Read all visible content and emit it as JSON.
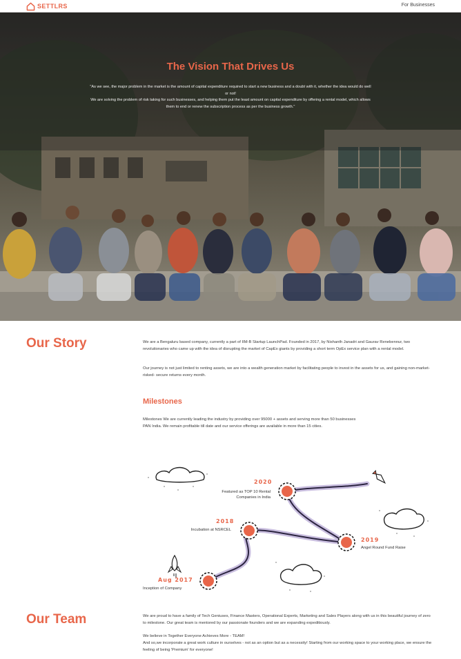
{
  "nav": {
    "logo_text": "SETTLRS",
    "for_businesses": "For Businesses"
  },
  "hero": {
    "title": "The Vision That Drives Us",
    "quote_line1": "\"As we see, the major problem in the market is the amount of capital expenditure required to start a new business and a doubt with it, whether the idea would do well or not!",
    "quote_line2": "We are solving the problem of risk taking for such businesses, and helping them put the least amount on capital expenditure by offering a rental model, which allows them to end or renew the subscription process as per the business growth.\""
  },
  "story": {
    "title": "Our Story",
    "para1": "We are a Bengaluru based company, currently a part of IIM-B Startup LaunchPad. Founded in 2017, by Nishanth Janadri and Gaurav Renebennur, two revolutionaries who came up with the idea of disrupting the market of CapEx giants by providing a short term OpEx service plan with a rental model.",
    "para2": "Our journey is not just limited to renting assets, we are into a wealth generation market by facilitating people to invest in the assets for us, and gaining non-market- risked- secure returns every month."
  },
  "milestones": {
    "title": "Milestones",
    "text": "Milestones We are currently leading the industry by providing over 95000 + assets and serving more than 50 businesses PAN India. We remain profitable till date and our service offerings are available in more than 15 cities.",
    "items": [
      {
        "year": "2020",
        "label": "Featured as TOP 10 Rental Companies in India"
      },
      {
        "year": "2018",
        "label": "Incubation at NSRCEL"
      },
      {
        "year": "2019",
        "label": "Angel Round Fund Raise"
      },
      {
        "year": "Aug 2017",
        "label": "Inception of Company"
      }
    ]
  },
  "team": {
    "title": "Our Team",
    "para1": "We are proud to have a family of Tech Geniuses, Finance Masters, Operational Experts, Marketing and Sales Players along with us in this beautiful journey of zero to milestone. Our great team is mentored by our passionate founders and we are expanding expeditiously.",
    "para2": "We believe in Together Everyone Achieves More - TEAM!",
    "para3": "And so,we incorporate a great work culture in ourselves - not as an option but as a necessity! Starting from our working space to your working place, we ensure the feeling of being 'Premium' for everyone!"
  },
  "colors": {
    "accent": "#e8664a",
    "path": "#c9bedf",
    "text": "#333333"
  }
}
